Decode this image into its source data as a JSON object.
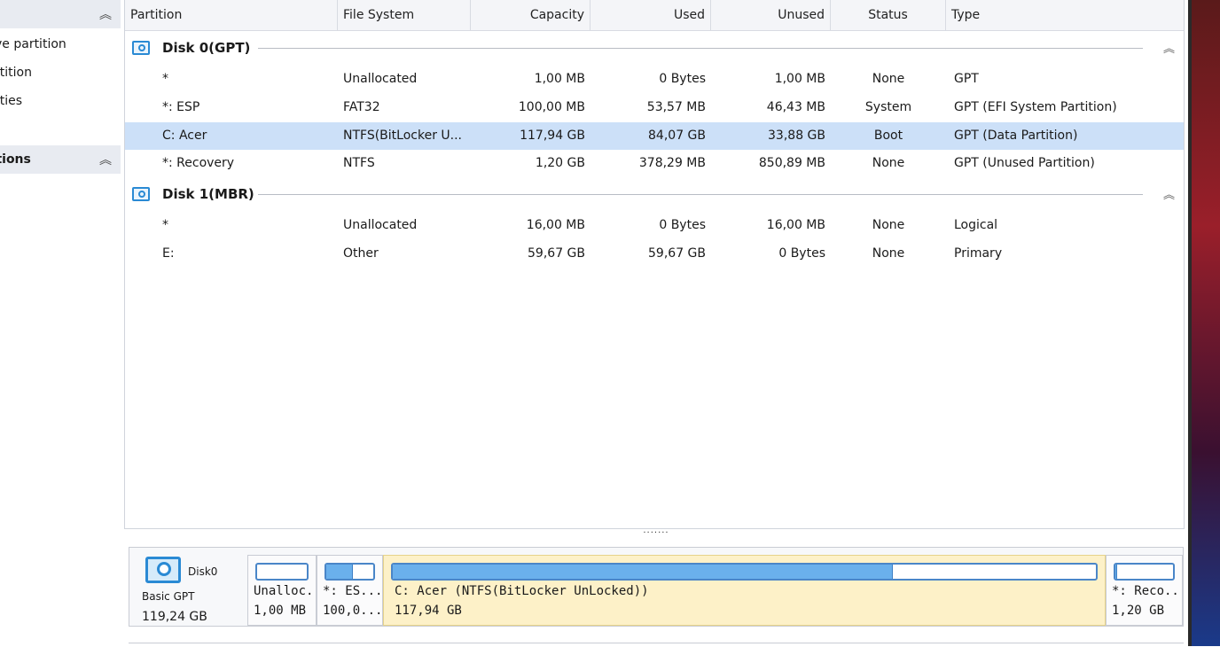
{
  "sidebar": {
    "items": [
      "ve partition",
      "rtition",
      "rties"
    ],
    "section2_title": "ations"
  },
  "table": {
    "headers": {
      "partition": "Partition",
      "file_system": "File System",
      "capacity": "Capacity",
      "used": "Used",
      "unused": "Unused",
      "status": "Status",
      "type": "Type"
    },
    "disks": [
      {
        "name": "Disk 0(GPT)",
        "rows": [
          {
            "partition": "*",
            "fs": "Unallocated",
            "capacity": "1,00 MB",
            "used": "0 Bytes",
            "unused": "1,00 MB",
            "status": "None",
            "type": "GPT"
          },
          {
            "partition": "*: ESP",
            "fs": "FAT32",
            "capacity": "100,00 MB",
            "used": "53,57 MB",
            "unused": "46,43 MB",
            "status": "System",
            "type": "GPT (EFI System Partition)"
          },
          {
            "partition": "C: Acer",
            "fs": "NTFS(BitLocker U...",
            "capacity": "117,94 GB",
            "used": "84,07 GB",
            "unused": "33,88 GB",
            "status": "Boot",
            "type": "GPT (Data Partition)"
          },
          {
            "partition": "*: Recovery",
            "fs": "NTFS",
            "capacity": "1,20 GB",
            "used": "378,29 MB",
            "unused": "850,89 MB",
            "status": "None",
            "type": "GPT (Unused Partition)"
          }
        ]
      },
      {
        "name": "Disk 1(MBR)",
        "rows": [
          {
            "partition": "*",
            "fs": "Unallocated",
            "capacity": "16,00 MB",
            "used": "0 Bytes",
            "unused": "16,00 MB",
            "status": "None",
            "type": "Logical"
          },
          {
            "partition": "E:",
            "fs": "Other",
            "capacity": "59,67 GB",
            "used": "59,67 GB",
            "unused": "0 Bytes",
            "status": "None",
            "type": "Primary"
          }
        ]
      }
    ]
  },
  "splitter_label": "·······",
  "diskmap": {
    "disk_name": "Disk0",
    "disk_type": "Basic GPT",
    "disk_size": "119,24 GB",
    "partitions": [
      {
        "line1": "Unalloc...",
        "line2": "1,00 MB",
        "used_fraction": 0.0
      },
      {
        "line1": "*: ES...",
        "line2": "100,0...",
        "used_fraction": 0.54
      },
      {
        "line1": "C: Acer (NTFS(BitLocker UnLocked))",
        "line2": "117,94 GB",
        "used_fraction": 0.71
      },
      {
        "line1": "*: Reco...",
        "line2": "1,20 GB",
        "used_fraction": 0.02
      }
    ]
  },
  "colors": {
    "accent": "#2a8ad4",
    "selected_row": "#cce0f8",
    "selected_block": "#fdf1c8",
    "used_fill": "#6ab0ec"
  }
}
